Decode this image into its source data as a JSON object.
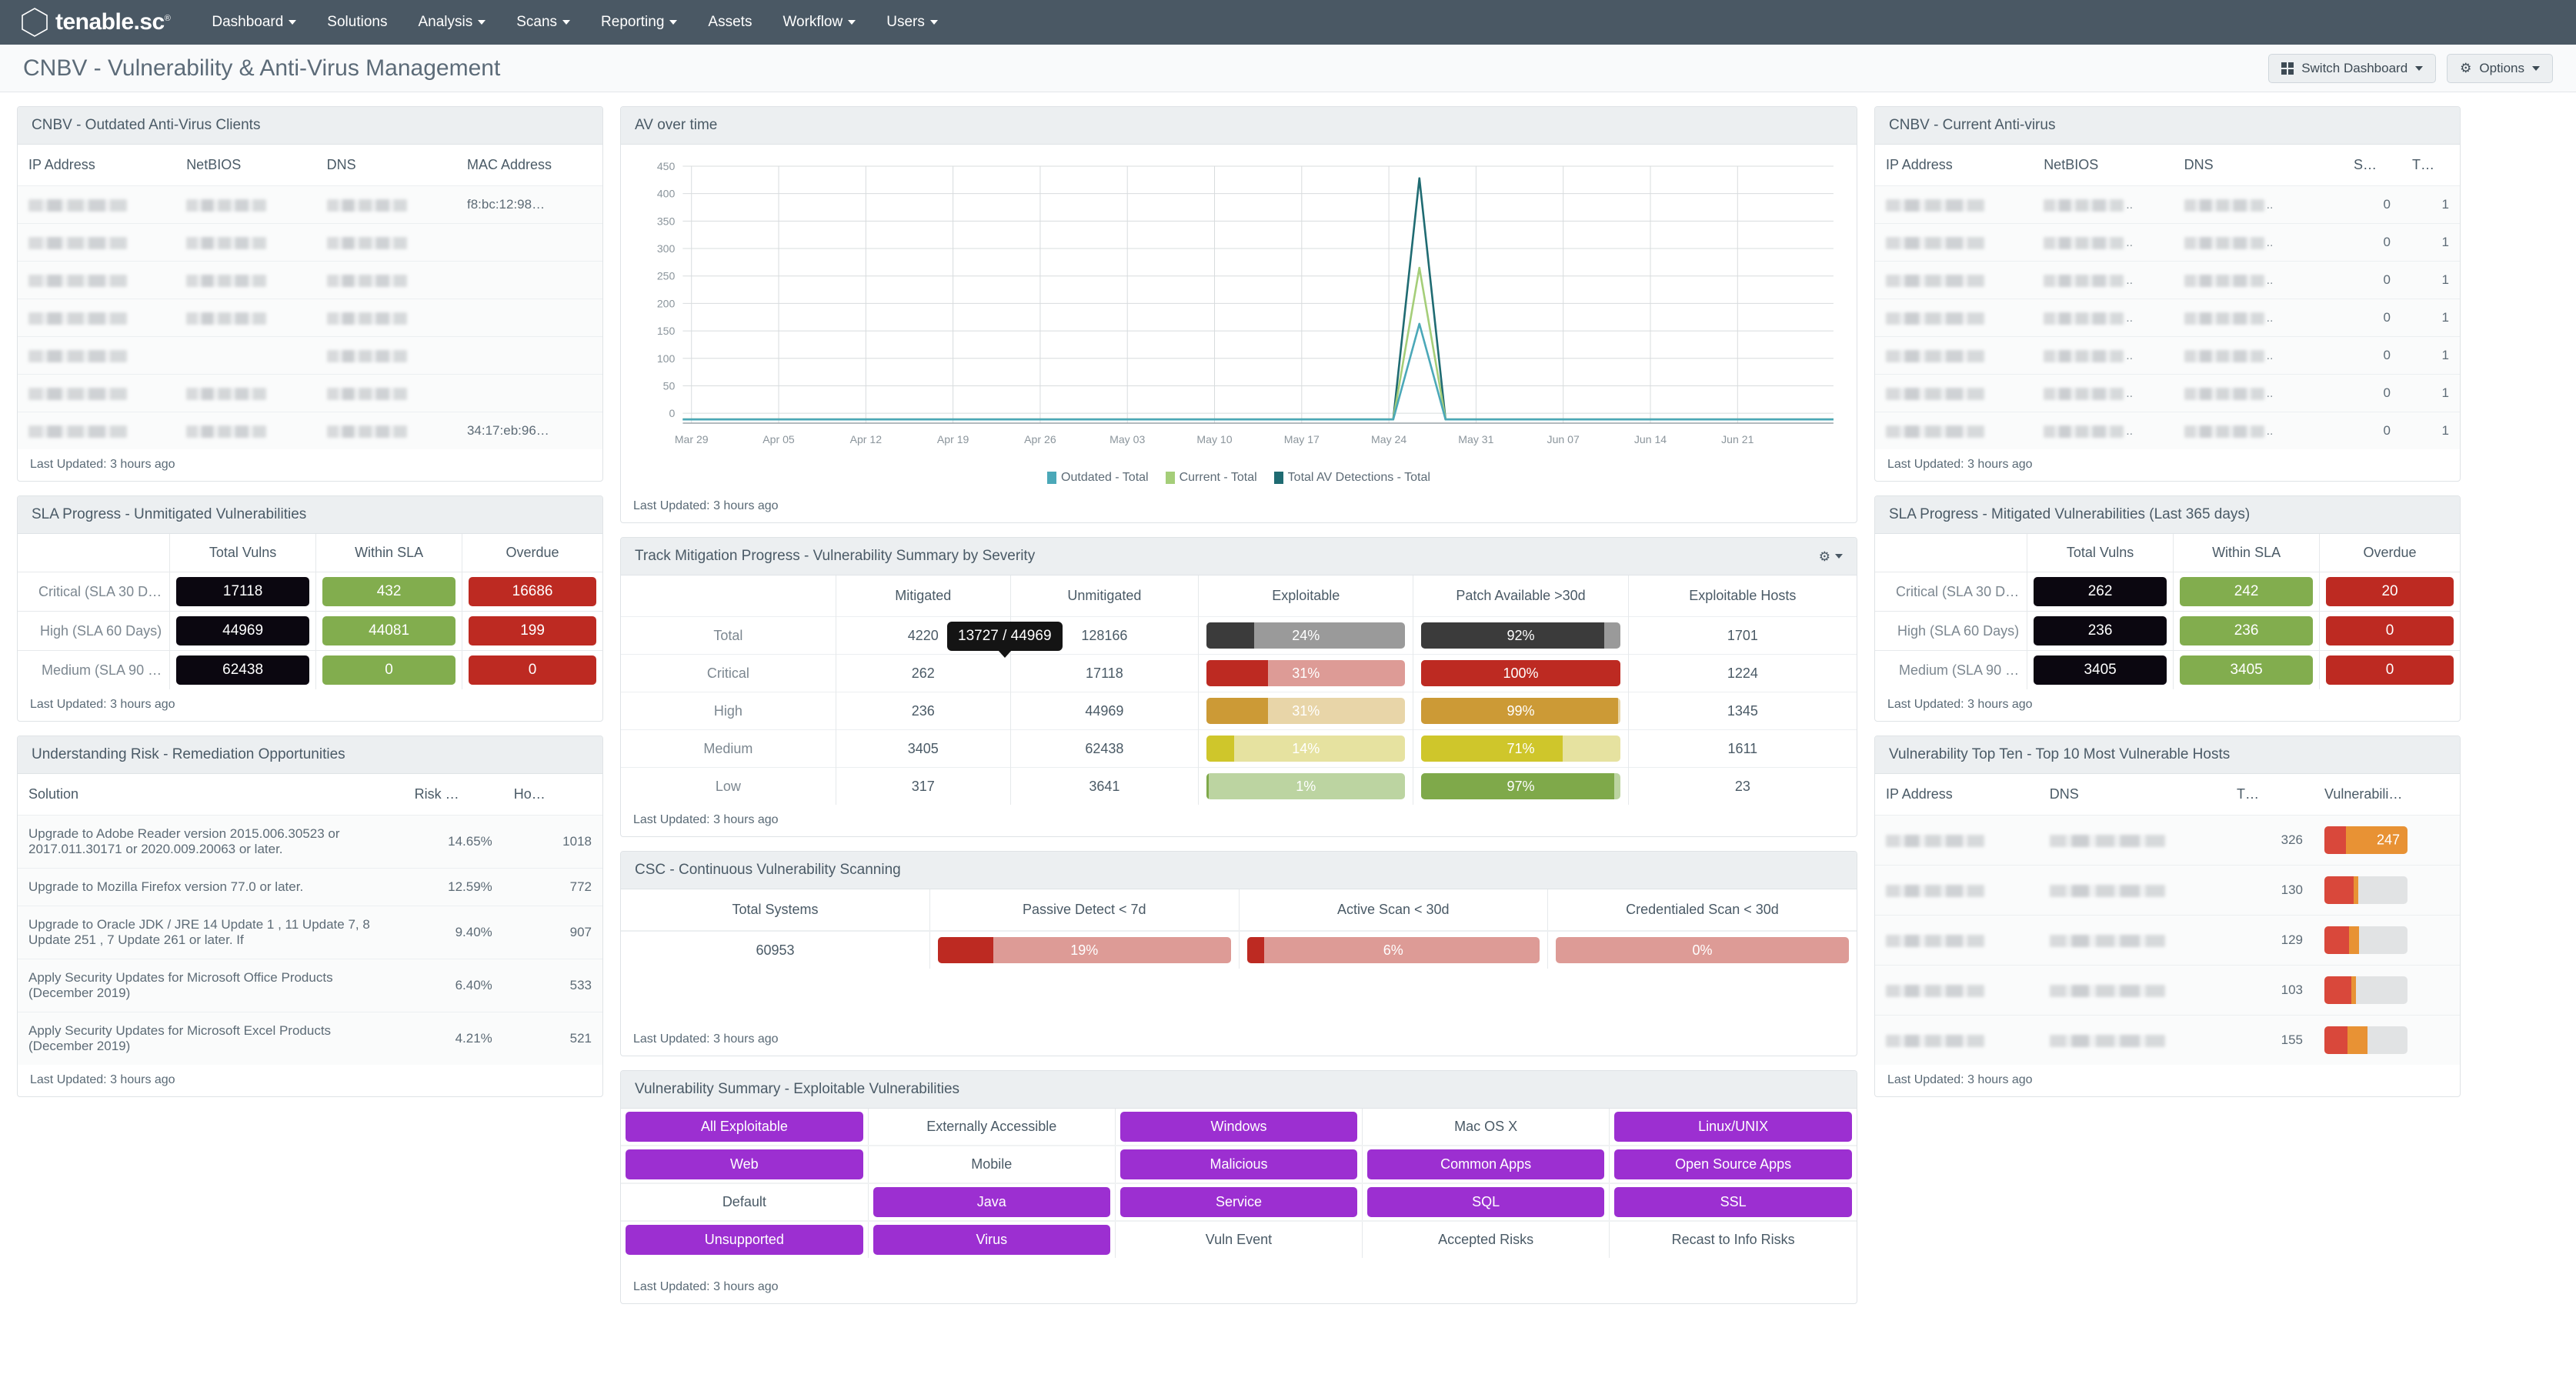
{
  "app": {
    "brand": "tenable.sc",
    "brand_tm": "®",
    "logo_icon": "hexagon-logo-icon"
  },
  "nav": {
    "items": [
      {
        "label": "Dashboard",
        "has_caret": true
      },
      {
        "label": "Solutions",
        "has_caret": false
      },
      {
        "label": "Analysis",
        "has_caret": true
      },
      {
        "label": "Scans",
        "has_caret": true
      },
      {
        "label": "Reporting",
        "has_caret": true
      },
      {
        "label": "Assets",
        "has_caret": false
      },
      {
        "label": "Workflow",
        "has_caret": true
      },
      {
        "label": "Users",
        "has_caret": true
      }
    ]
  },
  "header": {
    "title": "CNBV - Vulnerability & Anti-Virus Management",
    "switch_dashboard_label": "Switch Dashboard",
    "options_label": "Options"
  },
  "common": {
    "last_updated": "Last Updated: 3 hours ago"
  },
  "colors": {
    "nav_bg": "#4a5864",
    "accent_purple": "#9c2fd1",
    "green": "#82ad4e",
    "red": "#bd2a22",
    "black": "#0b0710",
    "orange": "#e89234",
    "series_outdated": "#4ba8b8",
    "series_current": "#a5ce79",
    "series_total": "#1f6b72"
  },
  "outdated_av": {
    "title": "CNBV - Outdated Anti-Virus Clients",
    "columns": [
      "IP Address",
      "NetBIOS",
      "DNS",
      "MAC Address"
    ],
    "rows": [
      {
        "ip": "redacted",
        "netbios": "redacted",
        "dns": "redacted",
        "mac": "f8:bc:12:98…"
      },
      {
        "ip": "redacted",
        "netbios": "redacted",
        "dns": "redacted",
        "mac": ""
      },
      {
        "ip": "redacted",
        "netbios": "redacted",
        "dns": "redacted",
        "mac": ""
      },
      {
        "ip": "redacted",
        "netbios": "redacted",
        "dns": "redacted",
        "mac": ""
      },
      {
        "ip": "redacted",
        "netbios": "",
        "dns": "redacted",
        "mac": ""
      },
      {
        "ip": "redacted",
        "netbios": "redacted",
        "dns": "redacted",
        "mac": ""
      },
      {
        "ip": "redacted",
        "netbios": "redacted",
        "dns": "redacted",
        "mac": "34:17:eb:96…"
      }
    ]
  },
  "sla_unmitigated": {
    "title": "SLA Progress - Unmitigated Vulnerabilities",
    "columns": [
      "",
      "Total Vulns",
      "Within SLA",
      "Overdue"
    ],
    "rows": [
      {
        "label": "Critical (SLA 30 D…",
        "total": "17118",
        "within": "432",
        "overdue": "16686"
      },
      {
        "label": "High (SLA 60 Days)",
        "total": "44969",
        "within": "44081",
        "overdue": "199"
      },
      {
        "label": "Medium (SLA 90 …",
        "total": "62438",
        "within": "0",
        "overdue": "0"
      }
    ]
  },
  "remediation": {
    "title": "Understanding Risk - Remediation Opportunities",
    "columns": [
      "Solution",
      "Risk …",
      "Ho…"
    ],
    "rows": [
      {
        "solution": "Upgrade to Adobe Reader version 2015.006.30523 or 2017.011.30171 or 2020.009.20063 or later.",
        "risk": "14.65%",
        "hosts": "1018"
      },
      {
        "solution": "Upgrade to Mozilla Firefox version 77.0 or later.",
        "risk": "12.59%",
        "hosts": "772"
      },
      {
        "solution": "Upgrade to Oracle JDK / JRE 14 Update 1 , 11 Update 7, 8 Update 251 , 7 Update 261 or later. If",
        "risk": "9.40%",
        "hosts": "907"
      },
      {
        "solution": "Apply Security Updates for Microsoft Office Products (December 2019)",
        "risk": "6.40%",
        "hosts": "533"
      },
      {
        "solution": "Apply Security Updates for Microsoft Excel Products (December 2019)",
        "risk": "4.21%",
        "hosts": "521"
      }
    ]
  },
  "av_chart": {
    "title": "AV over time"
  },
  "chart_data": {
    "type": "line",
    "title": "AV over time",
    "xlabel": "",
    "ylabel": "",
    "ylim": [
      -18,
      450
    ],
    "yticks": [
      0,
      50,
      100,
      150,
      200,
      250,
      300,
      350,
      400,
      450
    ],
    "grid": true,
    "legend_position": "bottom",
    "x": [
      "Mar 29",
      "Apr 05",
      "Apr 12",
      "Apr 19",
      "Apr 26",
      "May 03",
      "May 10",
      "May 17",
      "May 24",
      "May 31",
      "Jun 07",
      "Jun 14",
      "Jun 21"
    ],
    "series": [
      {
        "name": "Outdated - Total",
        "color": "#4ba8b8",
        "peak_x": "May 26",
        "peak_value": 163,
        "values": [
          0,
          0,
          0,
          0,
          0,
          0,
          0,
          0,
          0,
          0,
          0,
          0,
          0
        ]
      },
      {
        "name": "Current - Total",
        "color": "#a5ce79",
        "peak_x": "May 26",
        "peak_value": 265,
        "values": [
          0,
          0,
          0,
          0,
          0,
          0,
          0,
          0,
          0,
          0,
          0,
          0,
          0
        ]
      },
      {
        "name": "Total AV Detections - Total",
        "color": "#1f6b72",
        "peak_x": "May 26",
        "peak_value": 428,
        "values": [
          0,
          0,
          0,
          0,
          0,
          0,
          0,
          0,
          0,
          0,
          0,
          0,
          0
        ]
      }
    ]
  },
  "mitigation": {
    "title": "Track Mitigation Progress - Vulnerability Summary by Severity",
    "gear_icon": "gear-icon",
    "columns": [
      "",
      "Mitigated",
      "Unmitigated",
      "Exploitable",
      "Patch Available >30d",
      "Exploitable Hosts"
    ],
    "tooltip": "13727 / 44969",
    "rows": [
      {
        "severity": "Total",
        "mitigated": "4220",
        "unmitigated": "128166",
        "exploitable_pct": "24%",
        "exploitable_value": 24,
        "exploitable_fill": "#3b3b3b",
        "exploitable_track": "#9a9a9a",
        "patch_pct": "92%",
        "patch_value": 92,
        "patch_fill": "#3b3b3b",
        "patch_track": "#9a9a9a",
        "hosts": "1701"
      },
      {
        "severity": "Critical",
        "mitigated": "262",
        "unmitigated": "17118",
        "exploitable_pct": "31%",
        "exploitable_value": 31,
        "exploitable_fill": "#bd2a22",
        "exploitable_track": "#dd9b96",
        "patch_pct": "100%",
        "patch_value": 100,
        "patch_fill": "#bd2a22",
        "patch_track": "#dd9b96",
        "hosts": "1224"
      },
      {
        "severity": "High",
        "mitigated": "236",
        "unmitigated": "44969",
        "exploitable_pct": "31%",
        "exploitable_value": 31,
        "exploitable_fill": "#cc9a36",
        "exploitable_track": "#e8d5a8",
        "patch_pct": "99%",
        "patch_value": 99,
        "patch_fill": "#cc9a36",
        "patch_track": "#e8d5a8",
        "hosts": "1345"
      },
      {
        "severity": "Medium",
        "mitigated": "3405",
        "unmitigated": "62438",
        "exploitable_pct": "14%",
        "exploitable_value": 14,
        "exploitable_fill": "#cfc62b",
        "exploitable_track": "#e6e2a0",
        "patch_pct": "71%",
        "patch_value": 71,
        "patch_fill": "#cfc62b",
        "patch_track": "#e6e2a0",
        "hosts": "1611"
      },
      {
        "severity": "Low",
        "mitigated": "317",
        "unmitigated": "3641",
        "exploitable_pct": "1%",
        "exploitable_value": 1,
        "exploitable_fill": "#7fa94a",
        "exploitable_track": "#bcd4a1",
        "patch_pct": "97%",
        "patch_value": 97,
        "patch_fill": "#7fa94a",
        "patch_track": "#bcd4a1",
        "hosts": "23"
      }
    ]
  },
  "csc": {
    "title": "CSC - Continuous Vulnerability Scanning",
    "columns": [
      "Total Systems",
      "Passive Detect < 7d",
      "Active Scan < 30d",
      "Credentialed Scan < 30d"
    ],
    "total_systems": "60953",
    "bars": [
      {
        "label": "19%",
        "value": 19,
        "fill": "#bd2a22",
        "track": "#dd9b96"
      },
      {
        "label": "6%",
        "value": 6,
        "fill": "#bd2a22",
        "track": "#dd9b96"
      },
      {
        "label": "0%",
        "value": 0,
        "fill": "#bd2a22",
        "track": "#dd9b96"
      }
    ]
  },
  "exploitable_summary": {
    "title": "Vulnerability Summary - Exploitable Vulnerabilities",
    "rows": [
      [
        {
          "label": "All Exploitable",
          "active": true
        },
        {
          "label": "Externally Accessible",
          "active": false
        },
        {
          "label": "Windows",
          "active": true
        },
        {
          "label": "Mac OS X",
          "active": false
        },
        {
          "label": "Linux/UNIX",
          "active": true
        }
      ],
      [
        {
          "label": "Web",
          "active": true
        },
        {
          "label": "Mobile",
          "active": false
        },
        {
          "label": "Malicious",
          "active": true
        },
        {
          "label": "Common Apps",
          "active": true
        },
        {
          "label": "Open Source Apps",
          "active": true
        }
      ],
      [
        {
          "label": "Default",
          "active": false
        },
        {
          "label": "Java",
          "active": true
        },
        {
          "label": "Service",
          "active": true
        },
        {
          "label": "SQL",
          "active": true
        },
        {
          "label": "SSL",
          "active": true
        }
      ],
      [
        {
          "label": "Unsupported",
          "active": true
        },
        {
          "label": "Virus",
          "active": true
        },
        {
          "label": "Vuln Event",
          "active": false
        },
        {
          "label": "Accepted Risks",
          "active": false
        },
        {
          "label": "Recast to Info Risks",
          "active": false
        }
      ]
    ]
  },
  "current_av": {
    "title": "CNBV - Current Anti-virus",
    "columns": [
      "IP Address",
      "NetBIOS",
      "DNS",
      "S…",
      "T…"
    ],
    "rows": [
      {
        "ip": "redacted",
        "netbios": "redacted",
        "dns": "redacted",
        "s": "0",
        "t": "1"
      },
      {
        "ip": "redacted",
        "netbios": "redacted",
        "dns": "redacted",
        "s": "0",
        "t": "1"
      },
      {
        "ip": "redacted",
        "netbios": "redacted",
        "dns": "redacted",
        "s": "0",
        "t": "1"
      },
      {
        "ip": "redacted",
        "netbios": "redacted",
        "dns": "redacted",
        "s": "0",
        "t": "1"
      },
      {
        "ip": "redacted",
        "netbios": "redacted",
        "dns": "redacted",
        "s": "0",
        "t": "1"
      },
      {
        "ip": "redacted",
        "netbios": "redacted",
        "dns": "redacted",
        "s": "0",
        "t": "1"
      },
      {
        "ip": "redacted",
        "netbios": "redacted",
        "dns": "redacted",
        "s": "0",
        "t": "1"
      }
    ]
  },
  "sla_mitigated": {
    "title": "SLA Progress - Mitigated Vulnerabilities (Last 365 days)",
    "columns": [
      "",
      "Total Vulns",
      "Within SLA",
      "Overdue"
    ],
    "rows": [
      {
        "label": "Critical (SLA 30 D…",
        "total": "262",
        "within": "242",
        "overdue": "20"
      },
      {
        "label": "High (SLA 60 Days)",
        "total": "236",
        "within": "236",
        "overdue": "0"
      },
      {
        "label": "Medium (SLA 90 …",
        "total": "3405",
        "within": "3405",
        "overdue": "0"
      }
    ]
  },
  "top_ten": {
    "title": "Vulnerability Top Ten - Top 10 Most Vulnerable Hosts",
    "columns": [
      "IP Address",
      "DNS",
      "T…",
      "Vulnerabili…"
    ],
    "rows": [
      {
        "ip": "redacted",
        "dns": "redacted",
        "total": "326",
        "bar_label": "247",
        "critical_pct": 26,
        "high_pct": 74
      },
      {
        "ip": "redacted",
        "dns": "redacted",
        "total": "130",
        "bar_label": "",
        "critical_pct": 35,
        "high_pct": 6
      },
      {
        "ip": "redacted",
        "dns": "redacted",
        "total": "129",
        "bar_label": "",
        "critical_pct": 30,
        "high_pct": 12
      },
      {
        "ip": "redacted",
        "dns": "redacted",
        "total": "103",
        "bar_label": "",
        "critical_pct": 32,
        "high_pct": 6
      },
      {
        "ip": "redacted",
        "dns": "redacted",
        "total": "155",
        "bar_label": "",
        "critical_pct": 28,
        "high_pct": 24
      }
    ]
  }
}
